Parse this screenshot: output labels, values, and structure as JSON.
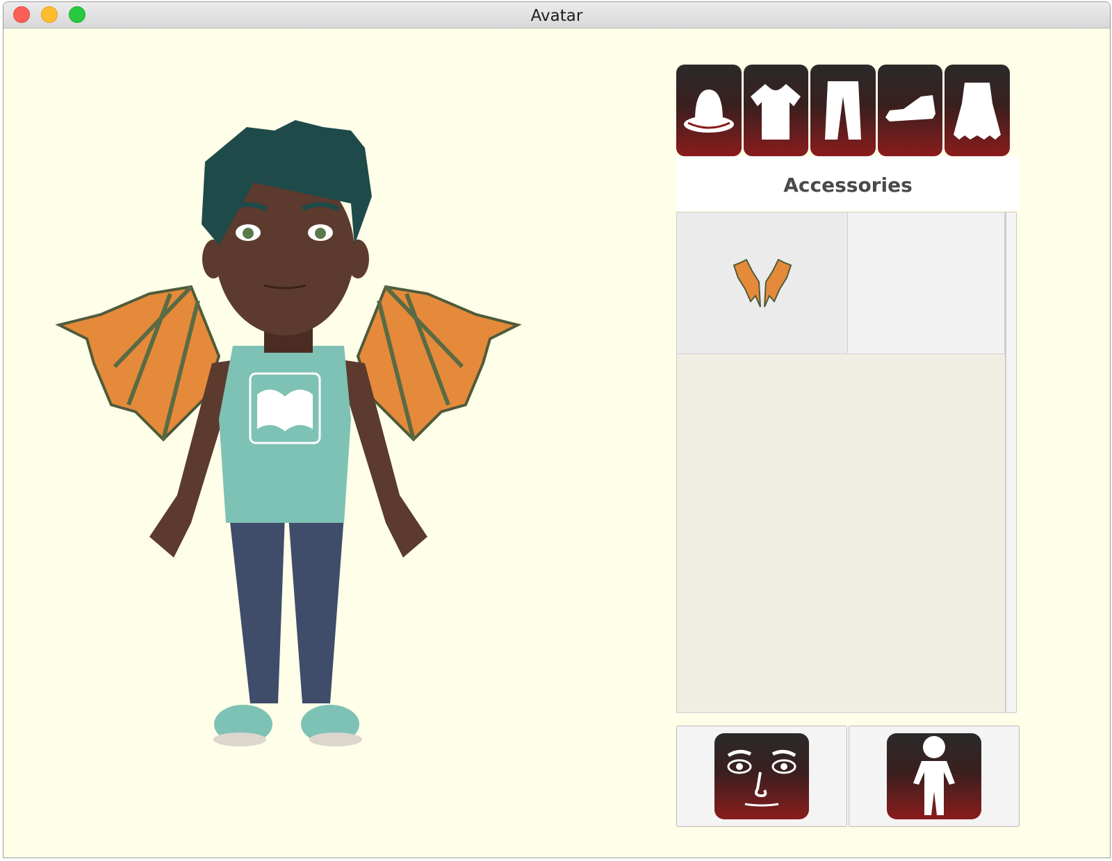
{
  "window": {
    "title": "Avatar"
  },
  "categories": [
    {
      "name": "hat",
      "icon": "hat-icon"
    },
    {
      "name": "shirt",
      "icon": "shirt-icon"
    },
    {
      "name": "pants",
      "icon": "pants-icon"
    },
    {
      "name": "shoes",
      "icon": "shoe-icon"
    },
    {
      "name": "accessories",
      "icon": "wings-icon"
    }
  ],
  "panel": {
    "category_label": "Accessories"
  },
  "items": [
    {
      "name": "dragon-wings",
      "icon": "wings-icon",
      "selected": true
    }
  ],
  "bottom_buttons": [
    {
      "name": "face",
      "icon": "face-icon"
    },
    {
      "name": "body",
      "icon": "person-icon"
    }
  ],
  "colors": {
    "background": "#fffee8",
    "tab_top": "#2a2a2a",
    "tab_bottom": "#8a1c1c",
    "skin": "#5c3a2e",
    "hair": "#1f4a4a",
    "shirt": "#7ec2b5",
    "jeans": "#3f4d6b",
    "wings": "#e58a3a"
  }
}
